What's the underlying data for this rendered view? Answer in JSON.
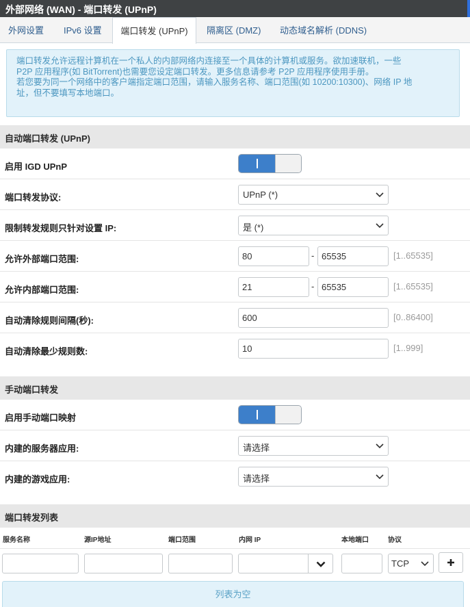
{
  "window": {
    "title": "外部网络 (WAN) - 端口转发 (UPnP)"
  },
  "tabs": [
    {
      "label": "外网设置"
    },
    {
      "label": "IPv6 设置"
    },
    {
      "label": "端口转发 (UPnP)"
    },
    {
      "label": "隔离区 (DMZ)"
    },
    {
      "label": "动态域名解析 (DDNS)"
    }
  ],
  "active_tab": "端口转发 (UPnP)",
  "note": {
    "lines": [
      "端口转发允许远程计算机在一个私人的内部网络内连接至一个具体的计算机或服务。欲加速联机，一些",
      "P2P 应用程序(如 BitTorrent)也需要您设定端口转发。更多信息请参考 P2P 应用程序使用手册。",
      "若您要为同一个网络中的客户端指定端口范围，请输入服务名称、端口范围(如 10200:10300)、网络 IP 地",
      "址，但不要填写本地端口。"
    ]
  },
  "upnp": {
    "section_title": "自动端口转发 (UPnP)",
    "enable_igd": {
      "label": "启用 IGD UPnP",
      "value": "on"
    },
    "protocol": {
      "label": "端口转发协议:",
      "value": "UPnP (*)"
    },
    "restrict_ip": {
      "label": "限制转发规则只针对设置 IP:",
      "value": "是 (*)"
    },
    "ext_range": {
      "label": "允许外部端口范围:",
      "from": "80",
      "to": "65535",
      "hint": "[1..65535]"
    },
    "int_range": {
      "label": "允许内部端口范围:",
      "from": "21",
      "to": "65535",
      "hint": "[1..65535]"
    },
    "clean_interval": {
      "label": "自动清除规则间隔(秒):",
      "value": "600",
      "hint": "[0..86400]"
    },
    "clean_min": {
      "label": "自动清除最少规则数:",
      "value": "10",
      "hint": "[1..999]"
    },
    "dash": "-"
  },
  "manual": {
    "section_title": "手动端口转发",
    "enable_manual": {
      "label": "启用手动端口映射",
      "value": "on"
    },
    "server_apps": {
      "label": "内建的服务器应用:",
      "value": "请选择"
    },
    "game_apps": {
      "label": "内建的游戏应用:",
      "value": "请选择"
    }
  },
  "list": {
    "section_title": "端口转发列表",
    "headers": [
      "服务名称",
      "源IP地址",
      "端口范围",
      "内网 IP",
      "本地端口",
      "协议"
    ],
    "new_row": {
      "service": "",
      "src_ip": "",
      "port_range": "",
      "lan_ip": "",
      "local_port": "",
      "protocol": "TCP"
    },
    "empty_text": "列表为空"
  },
  "colors": {
    "accent": "#3d7fca",
    "titlebar": "#3f4244",
    "note_bg": "#e2f2fa",
    "note_text": "#4c97c0"
  },
  "icons": {
    "dropdown": "chevron-down-icon",
    "add": "plus-icon"
  }
}
